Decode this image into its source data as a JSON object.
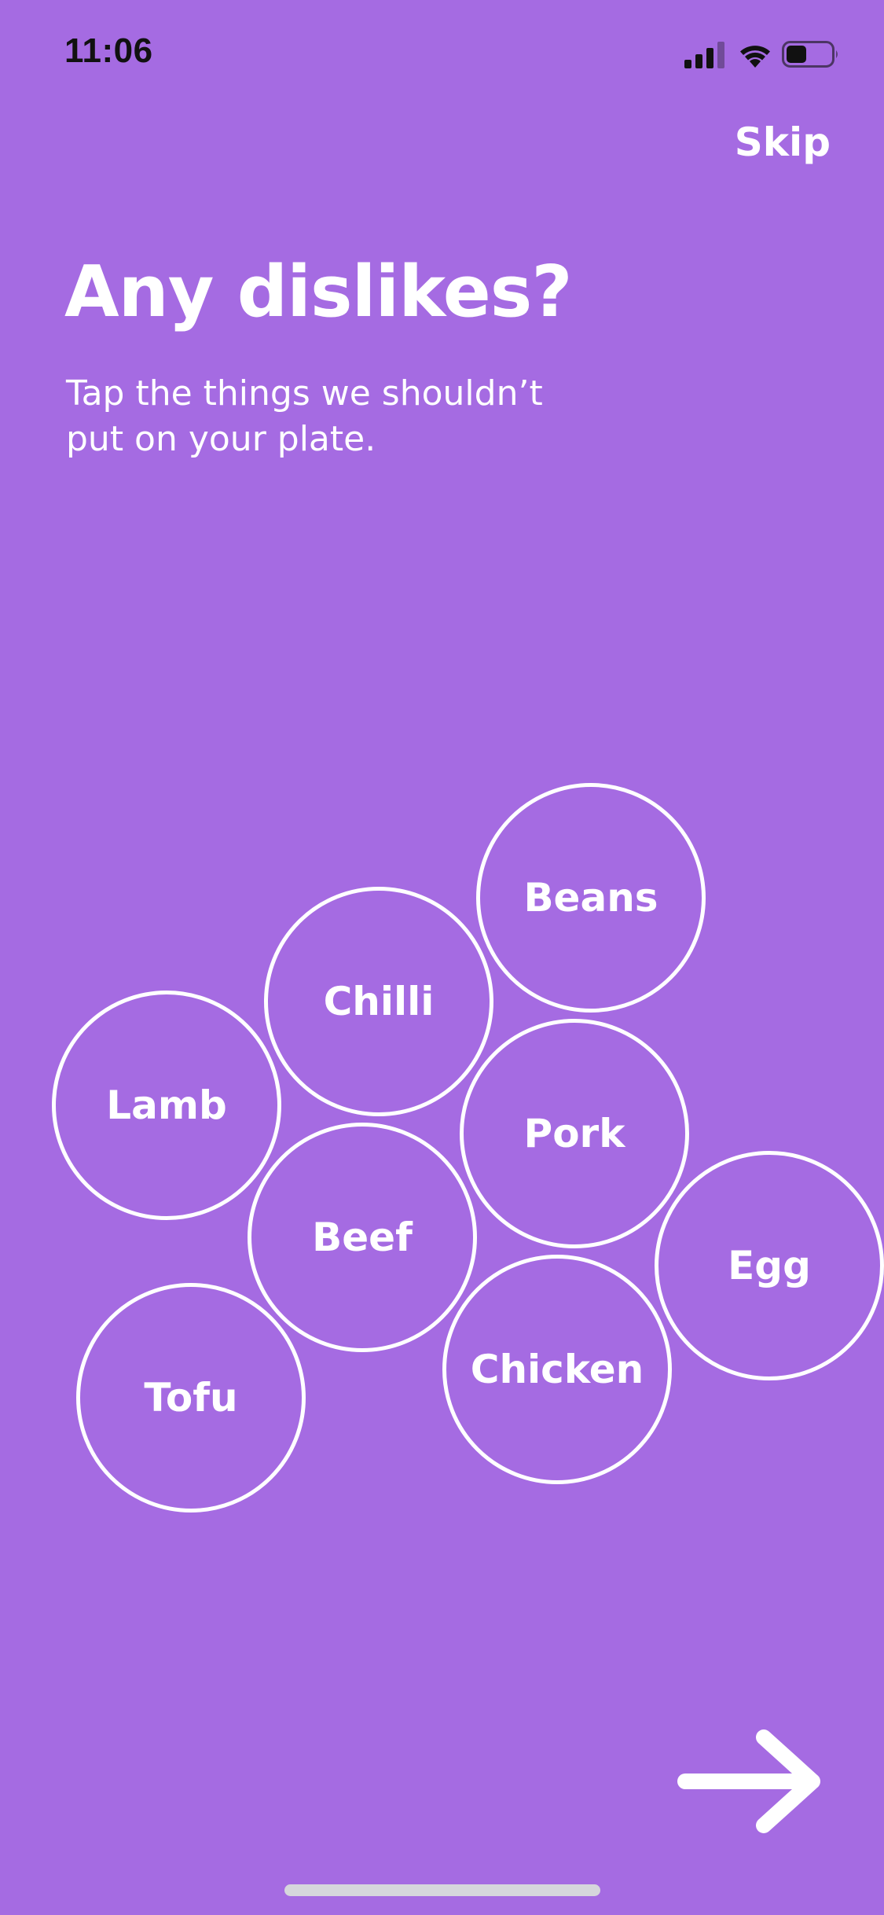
{
  "theme": {
    "background": "#a56be2",
    "foreground": "#ffffff",
    "status_text": "#111111"
  },
  "status_bar": {
    "time": "11:06",
    "icons": [
      "cellular-signal-icon",
      "wifi-icon",
      "battery-icon"
    ],
    "signal_bars_active": 3,
    "signal_bars_total": 4,
    "battery_level": 0.45
  },
  "header": {
    "skip_label": "Skip"
  },
  "main": {
    "title": "Any dislikes?",
    "subtitle": "Tap the things we shouldn’t put on your plate."
  },
  "options": [
    {
      "label": "Beans",
      "selected": false
    },
    {
      "label": "Chilli",
      "selected": false
    },
    {
      "label": "Lamb",
      "selected": false
    },
    {
      "label": "Pork",
      "selected": false
    },
    {
      "label": "Beef",
      "selected": false
    },
    {
      "label": "Egg",
      "selected": false
    },
    {
      "label": "Chicken",
      "selected": false
    },
    {
      "label": "Tofu",
      "selected": false
    }
  ],
  "footer": {
    "next_icon": "arrow-right-icon"
  }
}
